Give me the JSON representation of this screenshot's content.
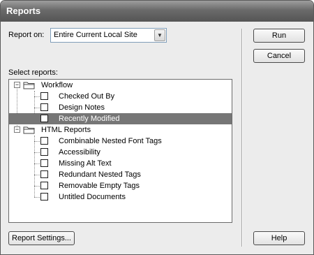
{
  "window": {
    "title": "Reports"
  },
  "report_on": {
    "label": "Report on:",
    "selected": "Entire Current Local Site"
  },
  "select_reports_label": "Select reports:",
  "tree": [
    {
      "kind": "group",
      "label": "Workflow",
      "items": [
        {
          "label": "Checked Out By",
          "checked": false,
          "selected": false
        },
        {
          "label": "Design Notes",
          "checked": false,
          "selected": false
        },
        {
          "label": "Recently Modified",
          "checked": false,
          "selected": true
        }
      ]
    },
    {
      "kind": "group",
      "label": "HTML Reports",
      "items": [
        {
          "label": "Combinable Nested Font Tags",
          "checked": false,
          "selected": false
        },
        {
          "label": "Accessibility",
          "checked": false,
          "selected": false
        },
        {
          "label": "Missing Alt Text",
          "checked": false,
          "selected": false
        },
        {
          "label": "Redundant Nested Tags",
          "checked": false,
          "selected": false
        },
        {
          "label": "Removable Empty Tags",
          "checked": false,
          "selected": false
        },
        {
          "label": "Untitled Documents",
          "checked": false,
          "selected": false
        }
      ]
    }
  ],
  "buttons": {
    "run": "Run",
    "cancel": "Cancel",
    "report_settings": "Report Settings...",
    "help": "Help"
  }
}
